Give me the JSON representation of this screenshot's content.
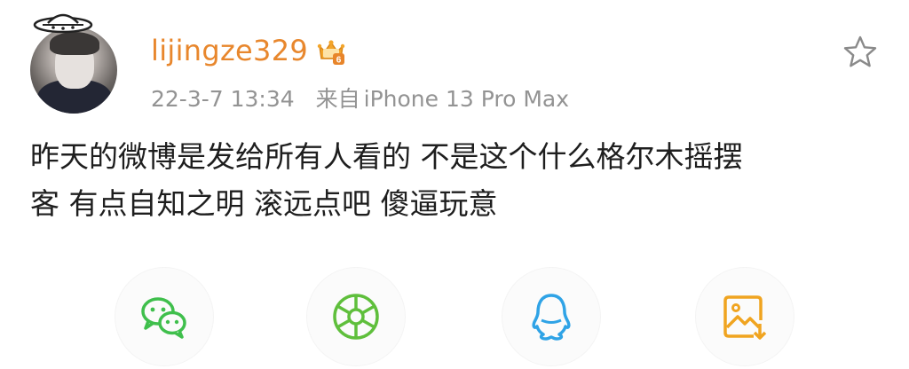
{
  "post": {
    "author": {
      "username": "lijingze329",
      "avatar_icon": "user-avatar",
      "badge_icon": "vip-crown-badge-icon",
      "badge_number": "6"
    },
    "timestamp": "22-3-7 13:34",
    "source_prefix": "来自",
    "source_device": "iPhone 13 Pro Max",
    "text_lines": [
      "昨天的微博是发给所有人看的 不是这个什么格尔木摇摆",
      "客 有点自知之明 滚远点吧 傻逼玩意"
    ],
    "favorite_icon": "star-outline-icon"
  },
  "share": {
    "buttons": [
      {
        "name": "wechat",
        "icon": "wechat-icon",
        "color": "#3fbf4c"
      },
      {
        "name": "moments",
        "icon": "wechat-moments-icon",
        "color": "#5fbf3c"
      },
      {
        "name": "qq",
        "icon": "qq-icon",
        "color": "#2fa3e6"
      },
      {
        "name": "save-image",
        "icon": "save-image-icon",
        "color": "#f0a420"
      }
    ]
  },
  "colors": {
    "username": "#e8872d",
    "meta": "#939393",
    "text": "#1e1e1e",
    "star_outline": "#8a8a8a"
  }
}
